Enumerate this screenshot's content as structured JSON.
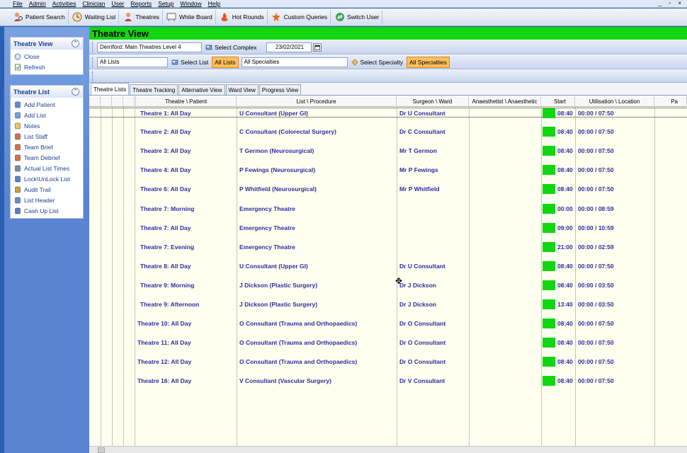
{
  "menu": [
    "File",
    "Admin",
    "Activities",
    "Clinician",
    "User",
    "Reports",
    "Setup",
    "Window",
    "Help"
  ],
  "window_buttons": "_ ▫ ×",
  "toolbar": [
    {
      "label": "Patient Search",
      "icon": "patient-search-icon"
    },
    {
      "label": "Waiting List",
      "icon": "clock-icon"
    },
    {
      "label": "Theatres",
      "icon": "theatre-icon"
    },
    {
      "label": "White Board",
      "icon": "whiteboard-icon"
    },
    {
      "label": "Hot Rounds",
      "icon": "hot-rounds-icon"
    },
    {
      "label": "Custom Queries",
      "icon": "custom-queries-icon"
    },
    {
      "label": "Switch User",
      "icon": "switch-user-icon"
    }
  ],
  "theatre_view_panel": {
    "title": "Theatre View",
    "items": [
      {
        "label": "Close",
        "icon": "close-icon"
      },
      {
        "label": "Refresh",
        "icon": "refresh-icon"
      }
    ]
  },
  "theatre_list_panel": {
    "title": "Theatre List",
    "items": [
      {
        "label": "Add Patient",
        "icon": "add-patient-icon"
      },
      {
        "label": "Add List",
        "icon": "add-list-icon"
      },
      {
        "label": "Notes",
        "icon": "notes-icon"
      },
      {
        "label": "List Staff",
        "icon": "staff-icon"
      },
      {
        "label": "Team Brief",
        "icon": "team-brief-icon"
      },
      {
        "label": "Team Debrief",
        "icon": "team-debrief-icon"
      },
      {
        "label": "Actual List Times",
        "icon": "list-times-icon"
      },
      {
        "label": "Lock\\UnLock List",
        "icon": "lock-icon"
      },
      {
        "label": "Audit Trail",
        "icon": "audit-icon"
      },
      {
        "label": "List Header",
        "icon": "list-header-icon"
      },
      {
        "label": "Cash Up List",
        "icon": "cash-up-icon"
      }
    ]
  },
  "main": {
    "title": "Theatre View",
    "complex_value": "Derriford: Main Theatres Level 4",
    "select_complex_label": "Select Complex",
    "date_value": "23/02/2021",
    "lists_value": "All Lists",
    "select_list_label": "Select List",
    "all_lists_toggle": "All Lists",
    "specialties_value": "All Specialties",
    "select_specialty_label": "Select Specialty",
    "all_specialties_toggle": "All Specialties"
  },
  "tabs": [
    "Theatre Lists",
    "Theatre Tracking",
    "Alternative View",
    "Ward View",
    "Progress View"
  ],
  "selected_tab": 0,
  "grid": {
    "columns": [
      "Theatre \\ Patient",
      "List \\ Procedure",
      "Surgeon \\ Ward",
      "Anaesthetist \\ Anaesthetic",
      "Start",
      "Utilisation \\ Location",
      "Pa"
    ],
    "status_color": "#11d611",
    "rows": [
      {
        "theatre": "Theatre 1: All Day",
        "list": "U Consultant (Upper GI)",
        "surgeon": "Dr U Consultant",
        "anaesthetist": "",
        "start": "08:40",
        "utilisation": "00:00 / 07:50"
      },
      {
        "theatre": "Theatre 2: All Day",
        "list": "C Consultant (Colorectal Surgery)",
        "surgeon": "Dr C Consultant",
        "anaesthetist": "",
        "start": "08:40",
        "utilisation": "00:00 / 07:50"
      },
      {
        "theatre": "Theatre 3: All Day",
        "list": "T Germon (Neurosurgical)",
        "surgeon": "Mr T Germon",
        "anaesthetist": "",
        "start": "08:40",
        "utilisation": "00:00 / 07:50"
      },
      {
        "theatre": "Theatre 4: All Day",
        "list": "P Fewings (Neurosurgical)",
        "surgeon": "Mr P Fewings",
        "anaesthetist": "",
        "start": "08:40",
        "utilisation": "00:00 / 07:50"
      },
      {
        "theatre": "Theatre 6: All Day",
        "list": "P Whitfield (Neurosurgical)",
        "surgeon": "Mr P Whitfield",
        "anaesthetist": "",
        "start": "08:40",
        "utilisation": "00:00 / 07:50"
      },
      {
        "theatre": "Theatre 7: Morning",
        "list": "Emergency Theatre",
        "surgeon": "",
        "anaesthetist": "",
        "start": "00:00",
        "utilisation": "00:00 / 08:59"
      },
      {
        "theatre": "Theatre 7: All Day",
        "list": "Emergency Theatre",
        "surgeon": "",
        "anaesthetist": "",
        "start": "09:00",
        "utilisation": "00:00 / 10:59"
      },
      {
        "theatre": "Theatre 7: Evening",
        "list": "Emergency Theatre",
        "surgeon": "",
        "anaesthetist": "",
        "start": "21:00",
        "utilisation": "00:00 / 02:59"
      },
      {
        "theatre": "Theatre 8: All Day",
        "list": "U Consultant (Upper GI)",
        "surgeon": "Dr U Consultant",
        "anaesthetist": "",
        "start": "08:40",
        "utilisation": "00:00 / 07:50"
      },
      {
        "theatre": "Theatre 9: Morning",
        "list": "J Dickson (Plastic Surgery)",
        "surgeon": "Dr J Dickson",
        "anaesthetist": "",
        "start": "08:40",
        "utilisation": "00:00 / 03:50"
      },
      {
        "theatre": "Theatre 9: Afternoon",
        "list": "J Dickson (Plastic Surgery)",
        "surgeon": "Dr J Dickson",
        "anaesthetist": "",
        "start": "13:40",
        "utilisation": "00:00 / 03:50"
      },
      {
        "theatre": "Theatre 10: All Day",
        "list": "O Consultant (Trauma and Orthopaedics)",
        "surgeon": "Dr O Consultant",
        "anaesthetist": "",
        "start": "08:40",
        "utilisation": "00:00 / 07:50"
      },
      {
        "theatre": "Theatre 11: All Day",
        "list": "O Consultant (Trauma and Orthopaedics)",
        "surgeon": "Dr O Consultant",
        "anaesthetist": "",
        "start": "08:40",
        "utilisation": "00:00 / 07:50"
      },
      {
        "theatre": "Theatre 12: All Day",
        "list": "O Consultant (Trauma and Orthopaedics)",
        "surgeon": "Dr O Consultant",
        "anaesthetist": "",
        "start": "08:40",
        "utilisation": "00:00 / 07:50"
      },
      {
        "theatre": "Theatre 16: All Day",
        "list": "V Consultant (Vascular Surgery)",
        "surgeon": "Dr V Consultant",
        "anaesthetist": "",
        "start": "08:40",
        "utilisation": "00:00 / 07:50"
      }
    ]
  }
}
